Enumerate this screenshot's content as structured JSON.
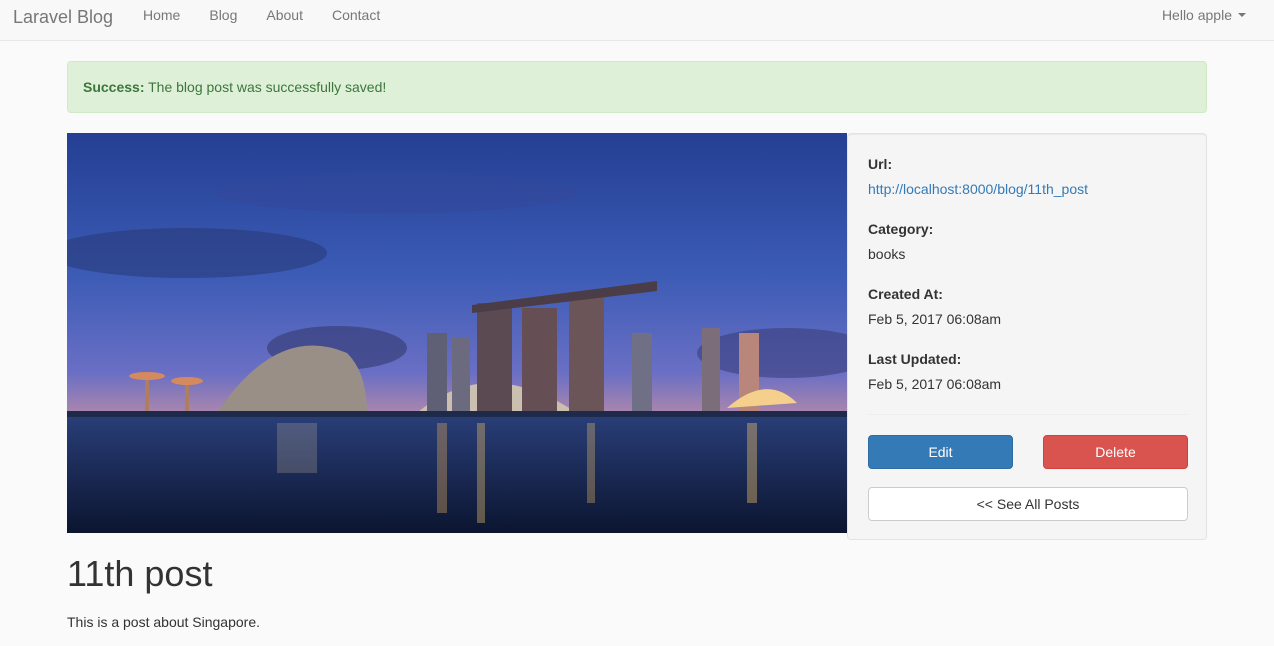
{
  "navbar": {
    "brand": "Laravel Blog",
    "links": [
      "Home",
      "Blog",
      "About",
      "Contact"
    ],
    "user_menu": "Hello apple"
  },
  "alert": {
    "label": "Success:",
    "message": "The blog post was successfully saved!"
  },
  "post": {
    "image_alt": "Singapore skyline at dusk",
    "title": "11th post",
    "body": "This is a post about Singapore."
  },
  "sidebar": {
    "url_label": "Url:",
    "url_value": "http://localhost:8000/blog/11th_post",
    "category_label": "Category:",
    "category_value": "books",
    "created_label": "Created At:",
    "created_value": "Feb 5, 2017 06:08am",
    "updated_label": "Last Updated:",
    "updated_value": "Feb 5, 2017 06:08am",
    "edit_label": "Edit",
    "delete_label": "Delete",
    "see_all_label": "<< See All Posts"
  },
  "colors": {
    "primary": "#337ab7",
    "danger": "#d9534f",
    "success_bg": "#dff0d8",
    "success_text": "#3c763d"
  }
}
